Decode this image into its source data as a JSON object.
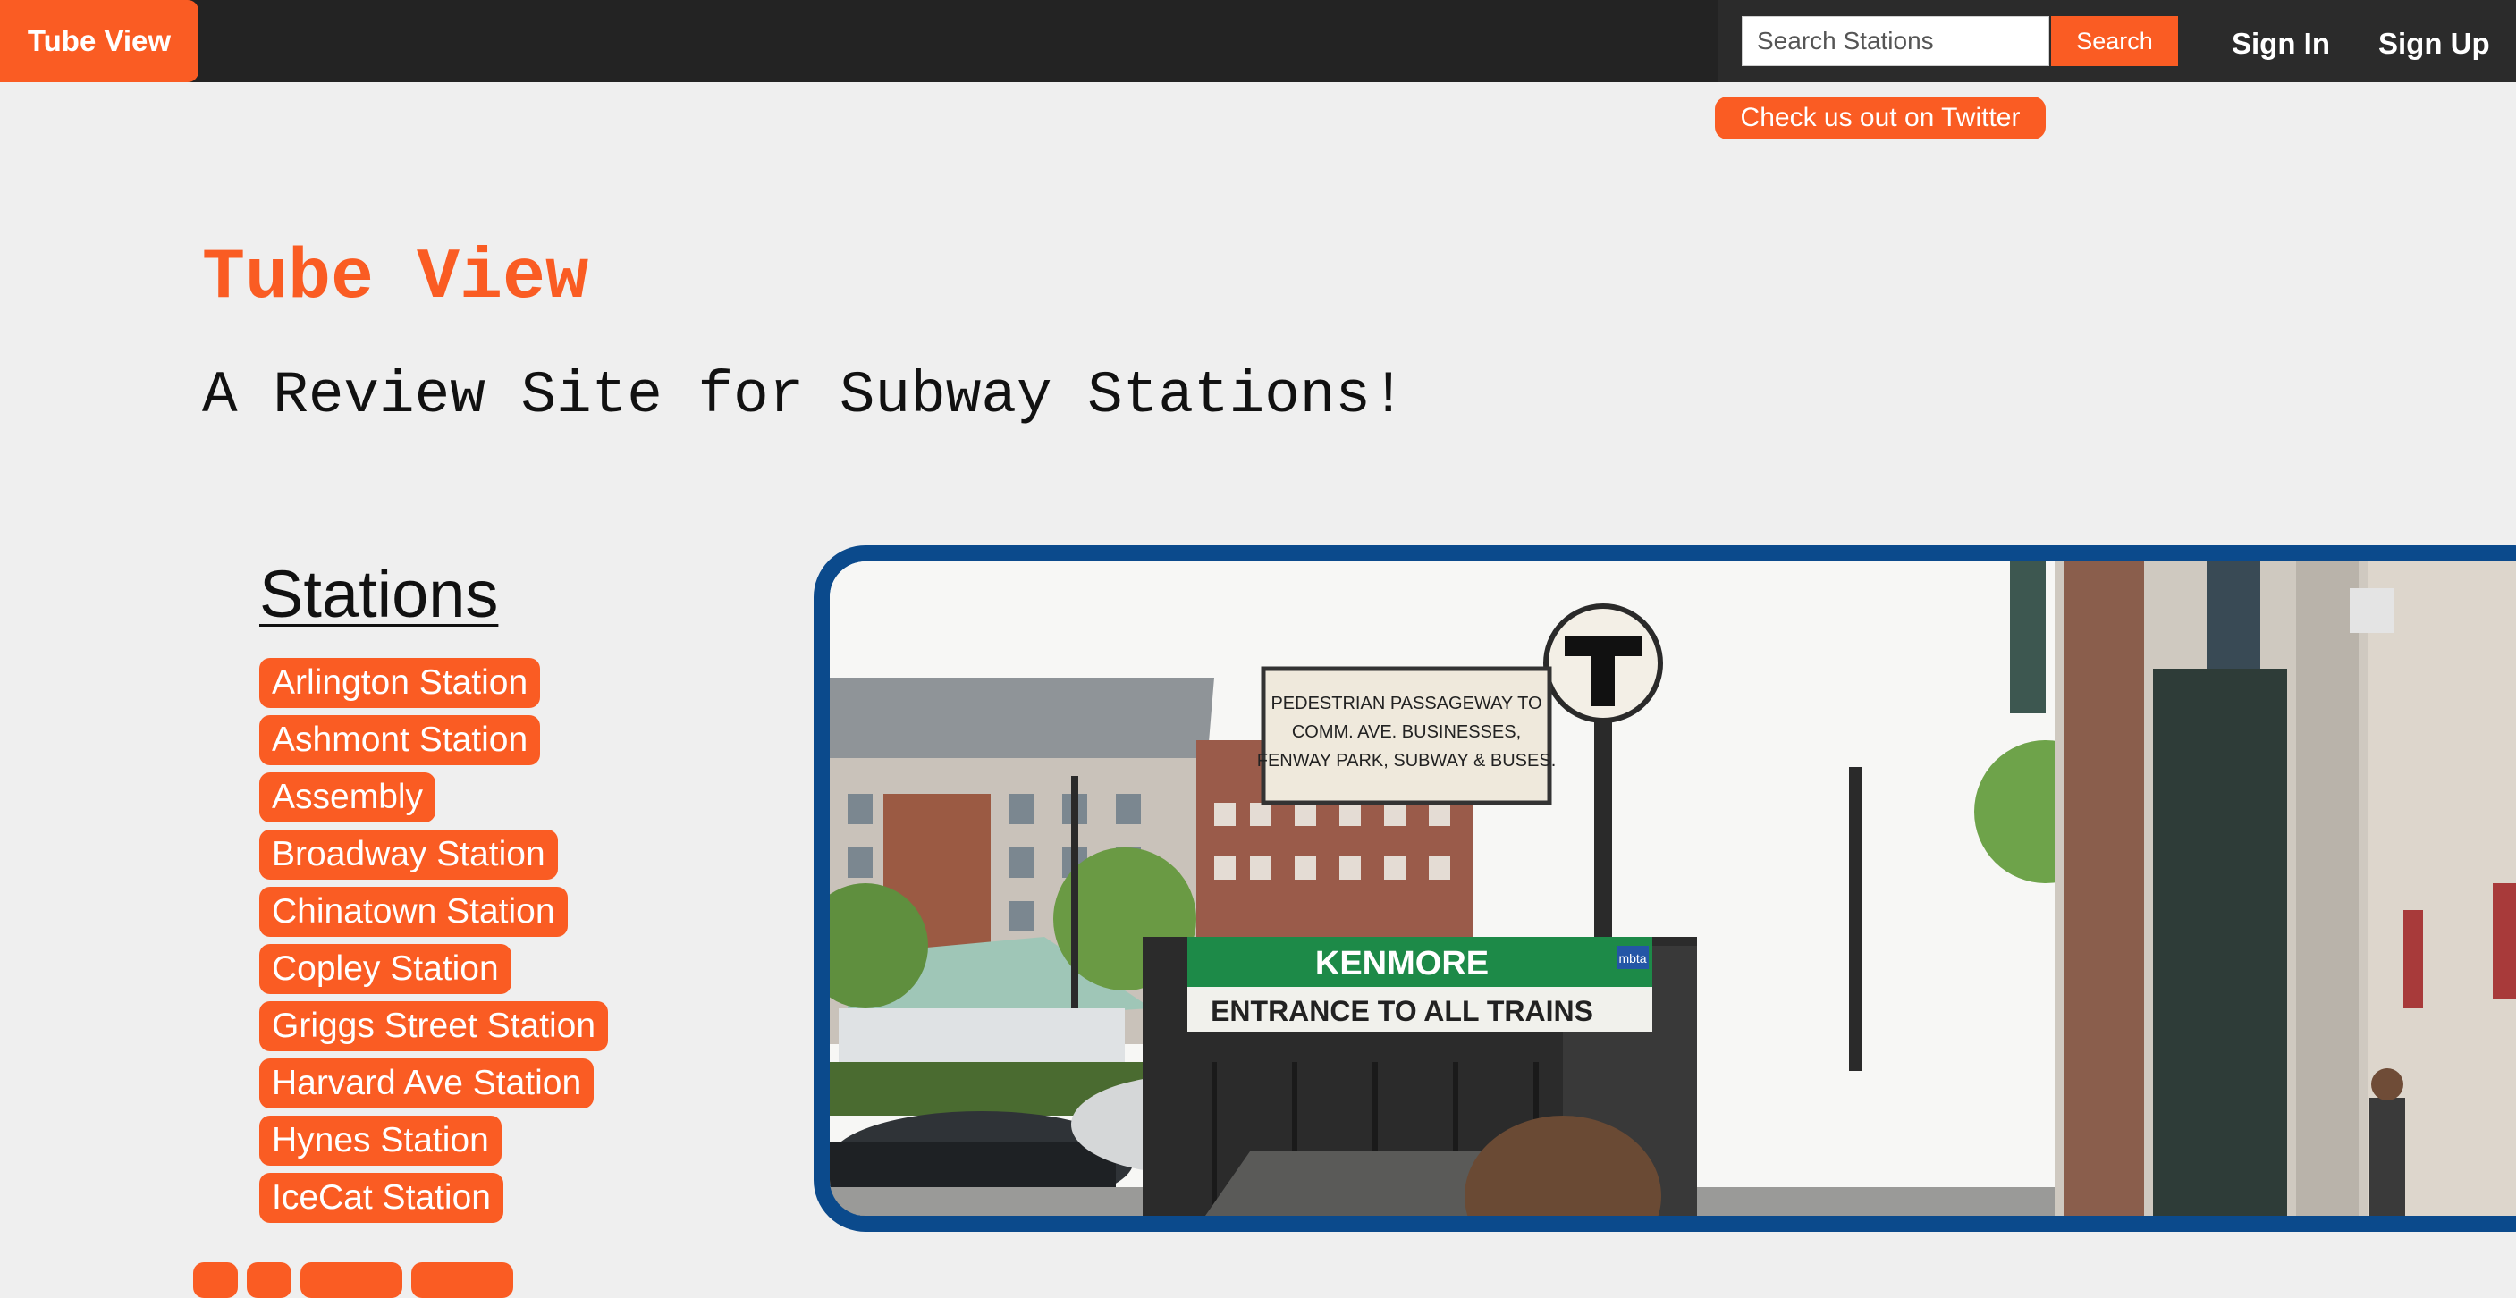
{
  "navbar": {
    "brand": "Tube View",
    "search_placeholder": "Search Stations",
    "search_button": "Search",
    "sign_in": "Sign In",
    "sign_up": "Sign Up"
  },
  "twitter_badge": "Check us out on Twitter",
  "hero": {
    "title": "Tube View",
    "subtitle": "A Review Site for Subway Stations!"
  },
  "stations": {
    "heading": "Stations",
    "items": [
      "Arlington Station",
      "Ashmont Station",
      "Assembly",
      "Broadway Station",
      "Chinatown Station",
      "Copley Station",
      "Griggs Street Station",
      "Harvard Ave Station",
      "Hynes Station",
      "IceCat Station"
    ]
  },
  "photo": {
    "sign_passageway": [
      "PEDESTRIAN PASSAGEWAY TO",
      "COMM. AVE. BUSINESSES,",
      "FENWAY PARK, SUBWAY & BUSES."
    ],
    "sign_station": "KENMORE",
    "sign_entrance": "ENTRANCE TO ALL TRAINS",
    "sign_t": "T",
    "sign_mbta": "mbta"
  },
  "colors": {
    "accent": "#fa5c23",
    "navbar": "#232323",
    "frame": "#0b4a8c",
    "background": "#efefef"
  }
}
